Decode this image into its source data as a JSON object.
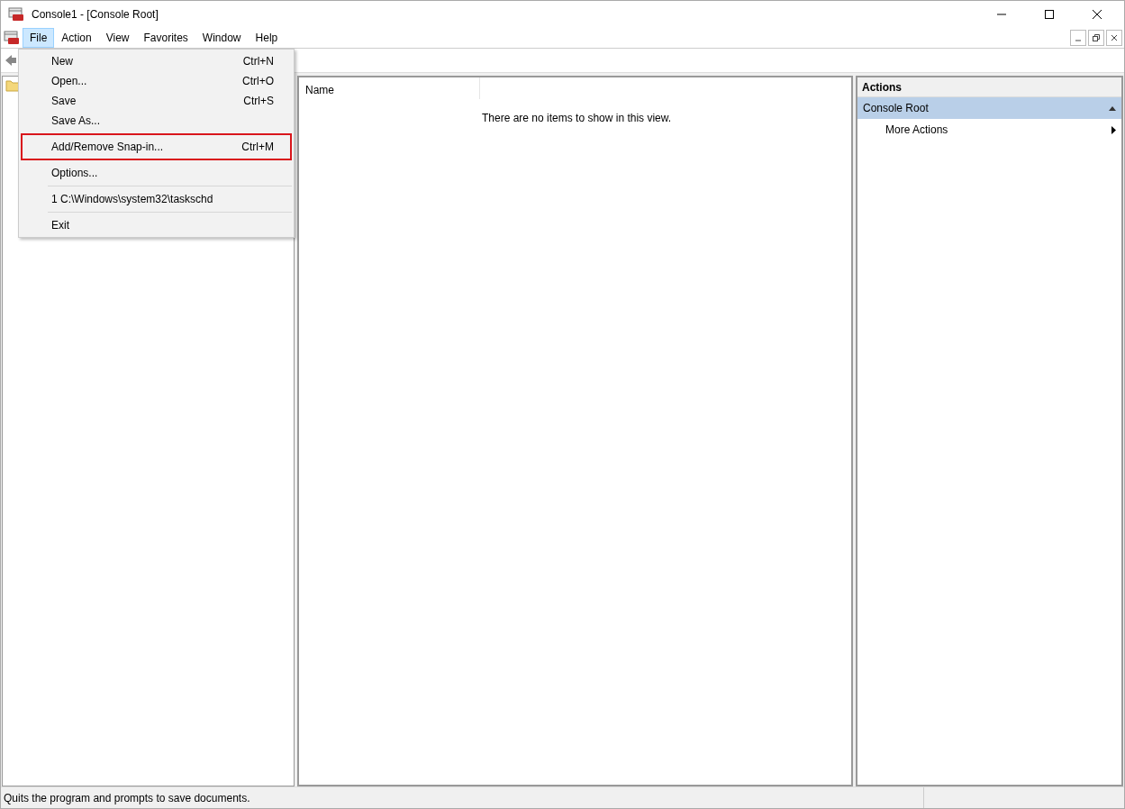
{
  "window": {
    "title": "Console1 - [Console Root]"
  },
  "menu_bar": [
    {
      "label": "File",
      "selected": true
    },
    {
      "label": "Action",
      "selected": false
    },
    {
      "label": "View",
      "selected": false
    },
    {
      "label": "Favorites",
      "selected": false
    },
    {
      "label": "Window",
      "selected": false
    },
    {
      "label": "Help",
      "selected": false
    }
  ],
  "file_menu": [
    {
      "kind": "item",
      "label": "New",
      "shortcut": "Ctrl+N",
      "highlighted": false
    },
    {
      "kind": "item",
      "label": "Open...",
      "shortcut": "Ctrl+O",
      "highlighted": false
    },
    {
      "kind": "item",
      "label": "Save",
      "shortcut": "Ctrl+S",
      "highlighted": false
    },
    {
      "kind": "item",
      "label": "Save As...",
      "highlighted": false
    },
    {
      "kind": "item",
      "label": "Add/Remove Snap-in...",
      "shortcut": "Ctrl+M",
      "highlighted": true
    },
    {
      "kind": "item",
      "label": "Options...",
      "highlighted": false
    },
    {
      "kind": "separator"
    },
    {
      "kind": "item",
      "label": "1 C:\\Windows\\system32\\taskschd",
      "highlighted": false
    },
    {
      "kind": "separator"
    },
    {
      "kind": "item",
      "label": "Exit",
      "highlighted": false
    }
  ],
  "list_view": {
    "columns": [
      "Name"
    ],
    "empty_message": "There are no items to show in this view."
  },
  "actions_pane": {
    "title": "Actions",
    "section": {
      "label": "Console Root",
      "expanded": true
    },
    "items": [
      "More Actions"
    ]
  },
  "status_bar": {
    "text": "Quits the program and prompts to save documents."
  }
}
